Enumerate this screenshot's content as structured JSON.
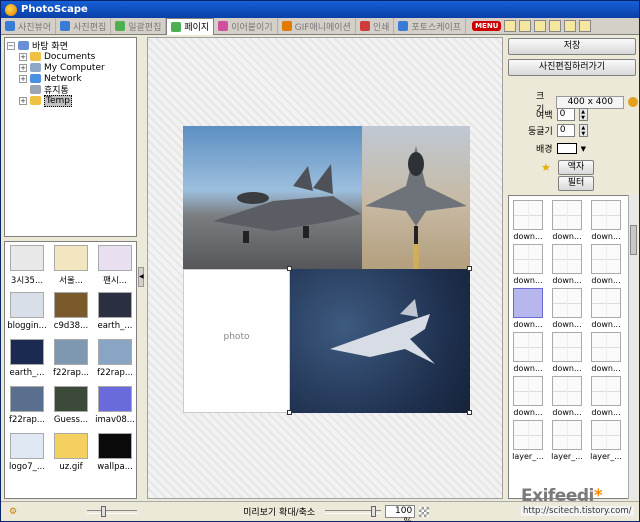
{
  "window": {
    "title": "PhotoScape"
  },
  "tabs": [
    {
      "label": "사진뷰어",
      "color": "#3a7bd5",
      "active": false
    },
    {
      "label": "사진편집",
      "color": "#3a7bd5",
      "active": false
    },
    {
      "label": "일괄편집",
      "color": "#4caf50",
      "active": false
    },
    {
      "label": "페이지",
      "color": "#4caf50",
      "active": true
    },
    {
      "label": "이어붙이기",
      "color": "#d04f9e",
      "active": false
    },
    {
      "label": "GIF애니메이션",
      "color": "#e07a00",
      "active": false
    },
    {
      "label": "인쇄",
      "color": "#d03c3c",
      "active": false
    },
    {
      "label": "포토스케이프",
      "color": "#3a7bd5",
      "active": false
    }
  ],
  "menu_label": "MENU",
  "tree": [
    {
      "label": "바탕 화면",
      "icon": "desktop-icon",
      "color": "#6b8fd6",
      "indent": 0,
      "expander": "−"
    },
    {
      "label": "Documents",
      "icon": "folder-icon",
      "color": "#f0c040",
      "indent": 1,
      "expander": "+"
    },
    {
      "label": "My Computer",
      "icon": "computer-icon",
      "color": "#8fa8c8",
      "indent": 1,
      "expander": "+"
    },
    {
      "label": "Network",
      "icon": "network-icon",
      "color": "#4a90e2",
      "indent": 1,
      "expander": "+"
    },
    {
      "label": "휴지통",
      "icon": "trash-icon",
      "color": "#9aa6b2",
      "indent": 1,
      "expander": ""
    },
    {
      "label": "Temp",
      "icon": "folder-icon",
      "color": "#f0c040",
      "indent": 1,
      "expander": "+",
      "selected": true
    }
  ],
  "thumbnails": [
    {
      "caption": "3시35...",
      "color": "#e8e8e8"
    },
    {
      "caption": "서울...",
      "color": "#f2e6c0"
    },
    {
      "caption": "팬시...",
      "color": "#e8e0f0"
    },
    {
      "caption": "bloggin...",
      "color": "#d8dfe8"
    },
    {
      "caption": "c9d38...",
      "color": "#7a5a2a"
    },
    {
      "caption": "earth_...",
      "color": "#2a3040"
    },
    {
      "caption": "earth_...",
      "color": "#1a2a50"
    },
    {
      "caption": "f22rap...",
      "color": "#7e98b2"
    },
    {
      "caption": "f22rap...",
      "color": "#8aa4c4"
    },
    {
      "caption": "f22rap...",
      "color": "#5a6e8e"
    },
    {
      "caption": "Guess...",
      "color": "#3c4a3a"
    },
    {
      "caption": "imav08...",
      "color": "#6a6adc"
    },
    {
      "caption": "logo7_...",
      "color": "#e0e8f4"
    },
    {
      "caption": "uz.gif",
      "color": "#f4d060"
    },
    {
      "caption": "wallpa...",
      "color": "#0a0a0a"
    }
  ],
  "canvas": {
    "placeholder": "photo"
  },
  "right": {
    "save_label": "저장",
    "edit_label": "사진편집하러가기",
    "size_label": "크기",
    "size_value": "400 x 400",
    "margin_label": "여백",
    "margin_value": "0",
    "round_label": "둥글기",
    "round_value": "0",
    "bg_label": "배경",
    "frame_label": "액자",
    "filter_label": "필터"
  },
  "templates": [
    {
      "caption": "down...",
      "highlight": false
    },
    {
      "caption": "down...",
      "highlight": false
    },
    {
      "caption": "down...",
      "highlight": false
    },
    {
      "caption": "down...",
      "highlight": false
    },
    {
      "caption": "down...",
      "highlight": false
    },
    {
      "caption": "down...",
      "highlight": false
    },
    {
      "caption": "down...",
      "highlight": true
    },
    {
      "caption": "down...",
      "highlight": false
    },
    {
      "caption": "down...",
      "highlight": false
    },
    {
      "caption": "down...",
      "highlight": false
    },
    {
      "caption": "down...",
      "highlight": false
    },
    {
      "caption": "down...",
      "highlight": false
    },
    {
      "caption": "down...",
      "highlight": false
    },
    {
      "caption": "down...",
      "highlight": false
    },
    {
      "caption": "down...",
      "highlight": false
    },
    {
      "caption": "layer_...",
      "highlight": false
    },
    {
      "caption": "layer_...",
      "highlight": false
    },
    {
      "caption": "layer_...",
      "highlight": false
    }
  ],
  "status": {
    "preview_label": "미리보기 확대/축소",
    "zoom_value": "100 %"
  },
  "watermark": {
    "logo": "Exifeedi",
    "url": "http://scitech.tistory.com/"
  }
}
